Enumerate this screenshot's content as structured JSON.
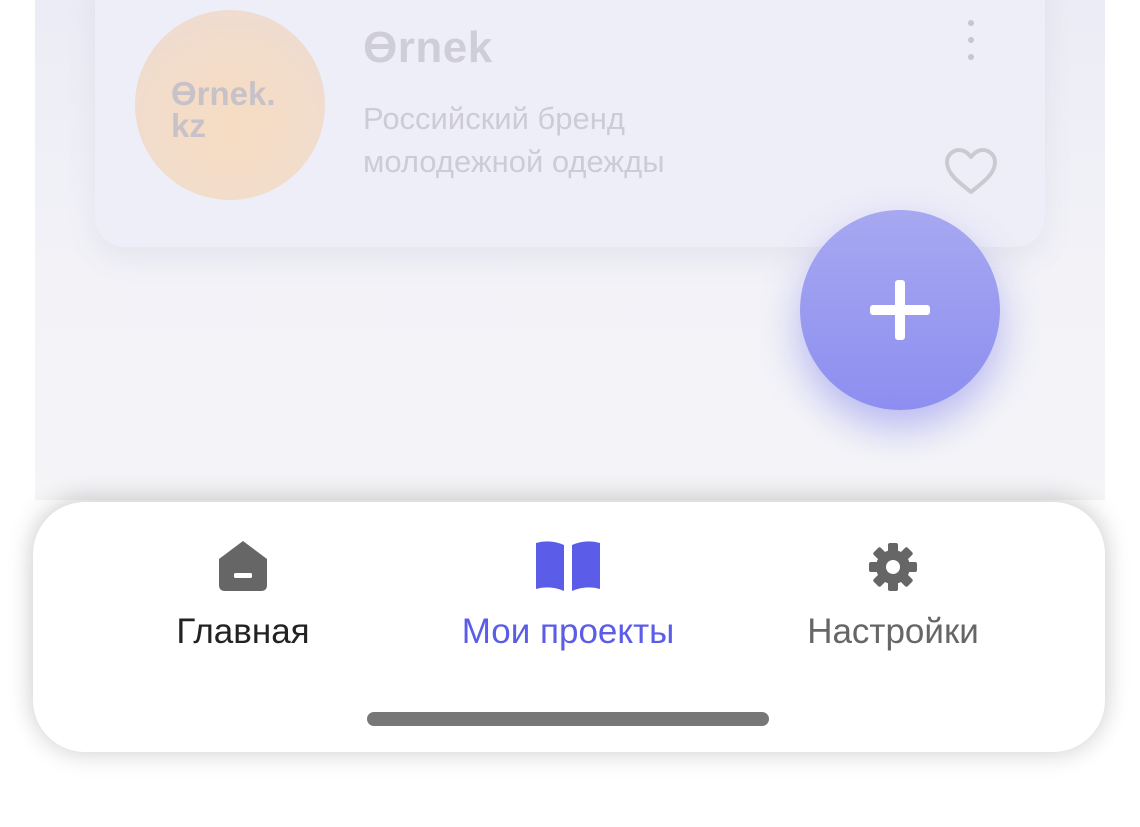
{
  "card": {
    "logo_text": "Ɵrnek.\nkz",
    "title": "Ɵrnek",
    "description": "Российский бренд молодежной одежды",
    "menu_icon": "more-vertical-icon",
    "favorite_icon": "heart-outline-icon"
  },
  "fab": {
    "icon": "plus-icon",
    "color": "#8e8ff0"
  },
  "tabbar": {
    "tabs": [
      {
        "label": "Главная",
        "icon": "home-icon",
        "color": "#222222",
        "icon_color": "#666666",
        "active": false
      },
      {
        "label": "Мои проекты",
        "icon": "book-open-icon",
        "color": "#5b5ce8",
        "icon_color": "#5b5ce8",
        "active": true
      },
      {
        "label": "Настройки",
        "icon": "gear-icon",
        "color": "#666666",
        "icon_color": "#666666",
        "active": false
      }
    ]
  }
}
